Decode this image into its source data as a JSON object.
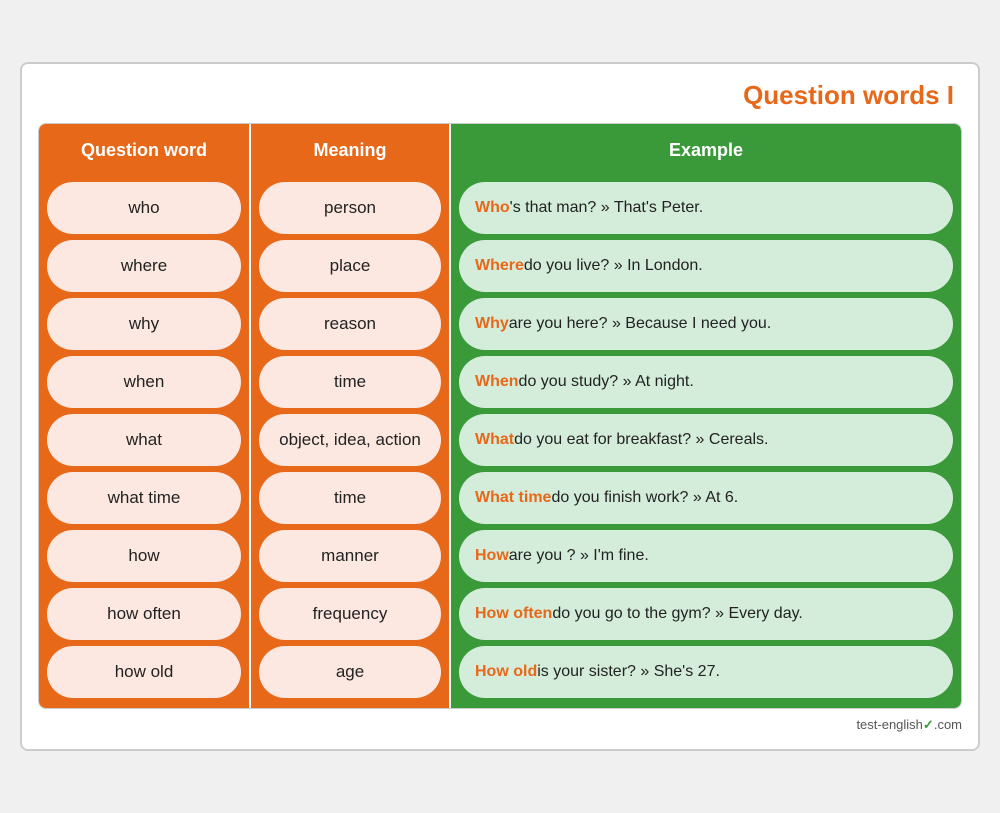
{
  "title": "Question words I",
  "columns": {
    "question_word": "Question word",
    "meaning": "Meaning",
    "example": "Example"
  },
  "rows": [
    {
      "question": "who",
      "meaning": "person",
      "example_word": "Who",
      "example_rest": "'s that man? » That's Peter."
    },
    {
      "question": "where",
      "meaning": "place",
      "example_word": "Where",
      "example_rest": " do you live? » In London."
    },
    {
      "question": "why",
      "meaning": "reason",
      "example_word": "Why",
      "example_rest": " are you here? » Because I need you."
    },
    {
      "question": "when",
      "meaning": "time",
      "example_word": "When",
      "example_rest": " do you study? » At night."
    },
    {
      "question": "what",
      "meaning": "object, idea, action",
      "example_word": "What",
      "example_rest": " do you eat for breakfast? » Cereals."
    },
    {
      "question": "what time",
      "meaning": "time",
      "example_word": "What time",
      "example_rest": " do you finish work? » At 6."
    },
    {
      "question": "how",
      "meaning": "manner",
      "example_word": "How",
      "example_rest": " are you ? » I'm fine."
    },
    {
      "question": "how often",
      "meaning": "frequency",
      "example_word": "How often",
      "example_rest": " do you go to the gym? » Every day."
    },
    {
      "question": "how old",
      "meaning": "age",
      "example_word": "How old",
      "example_rest": " is your sister? » She's 27."
    }
  ],
  "footer": {
    "site": "test-english",
    "tld": ".com"
  }
}
